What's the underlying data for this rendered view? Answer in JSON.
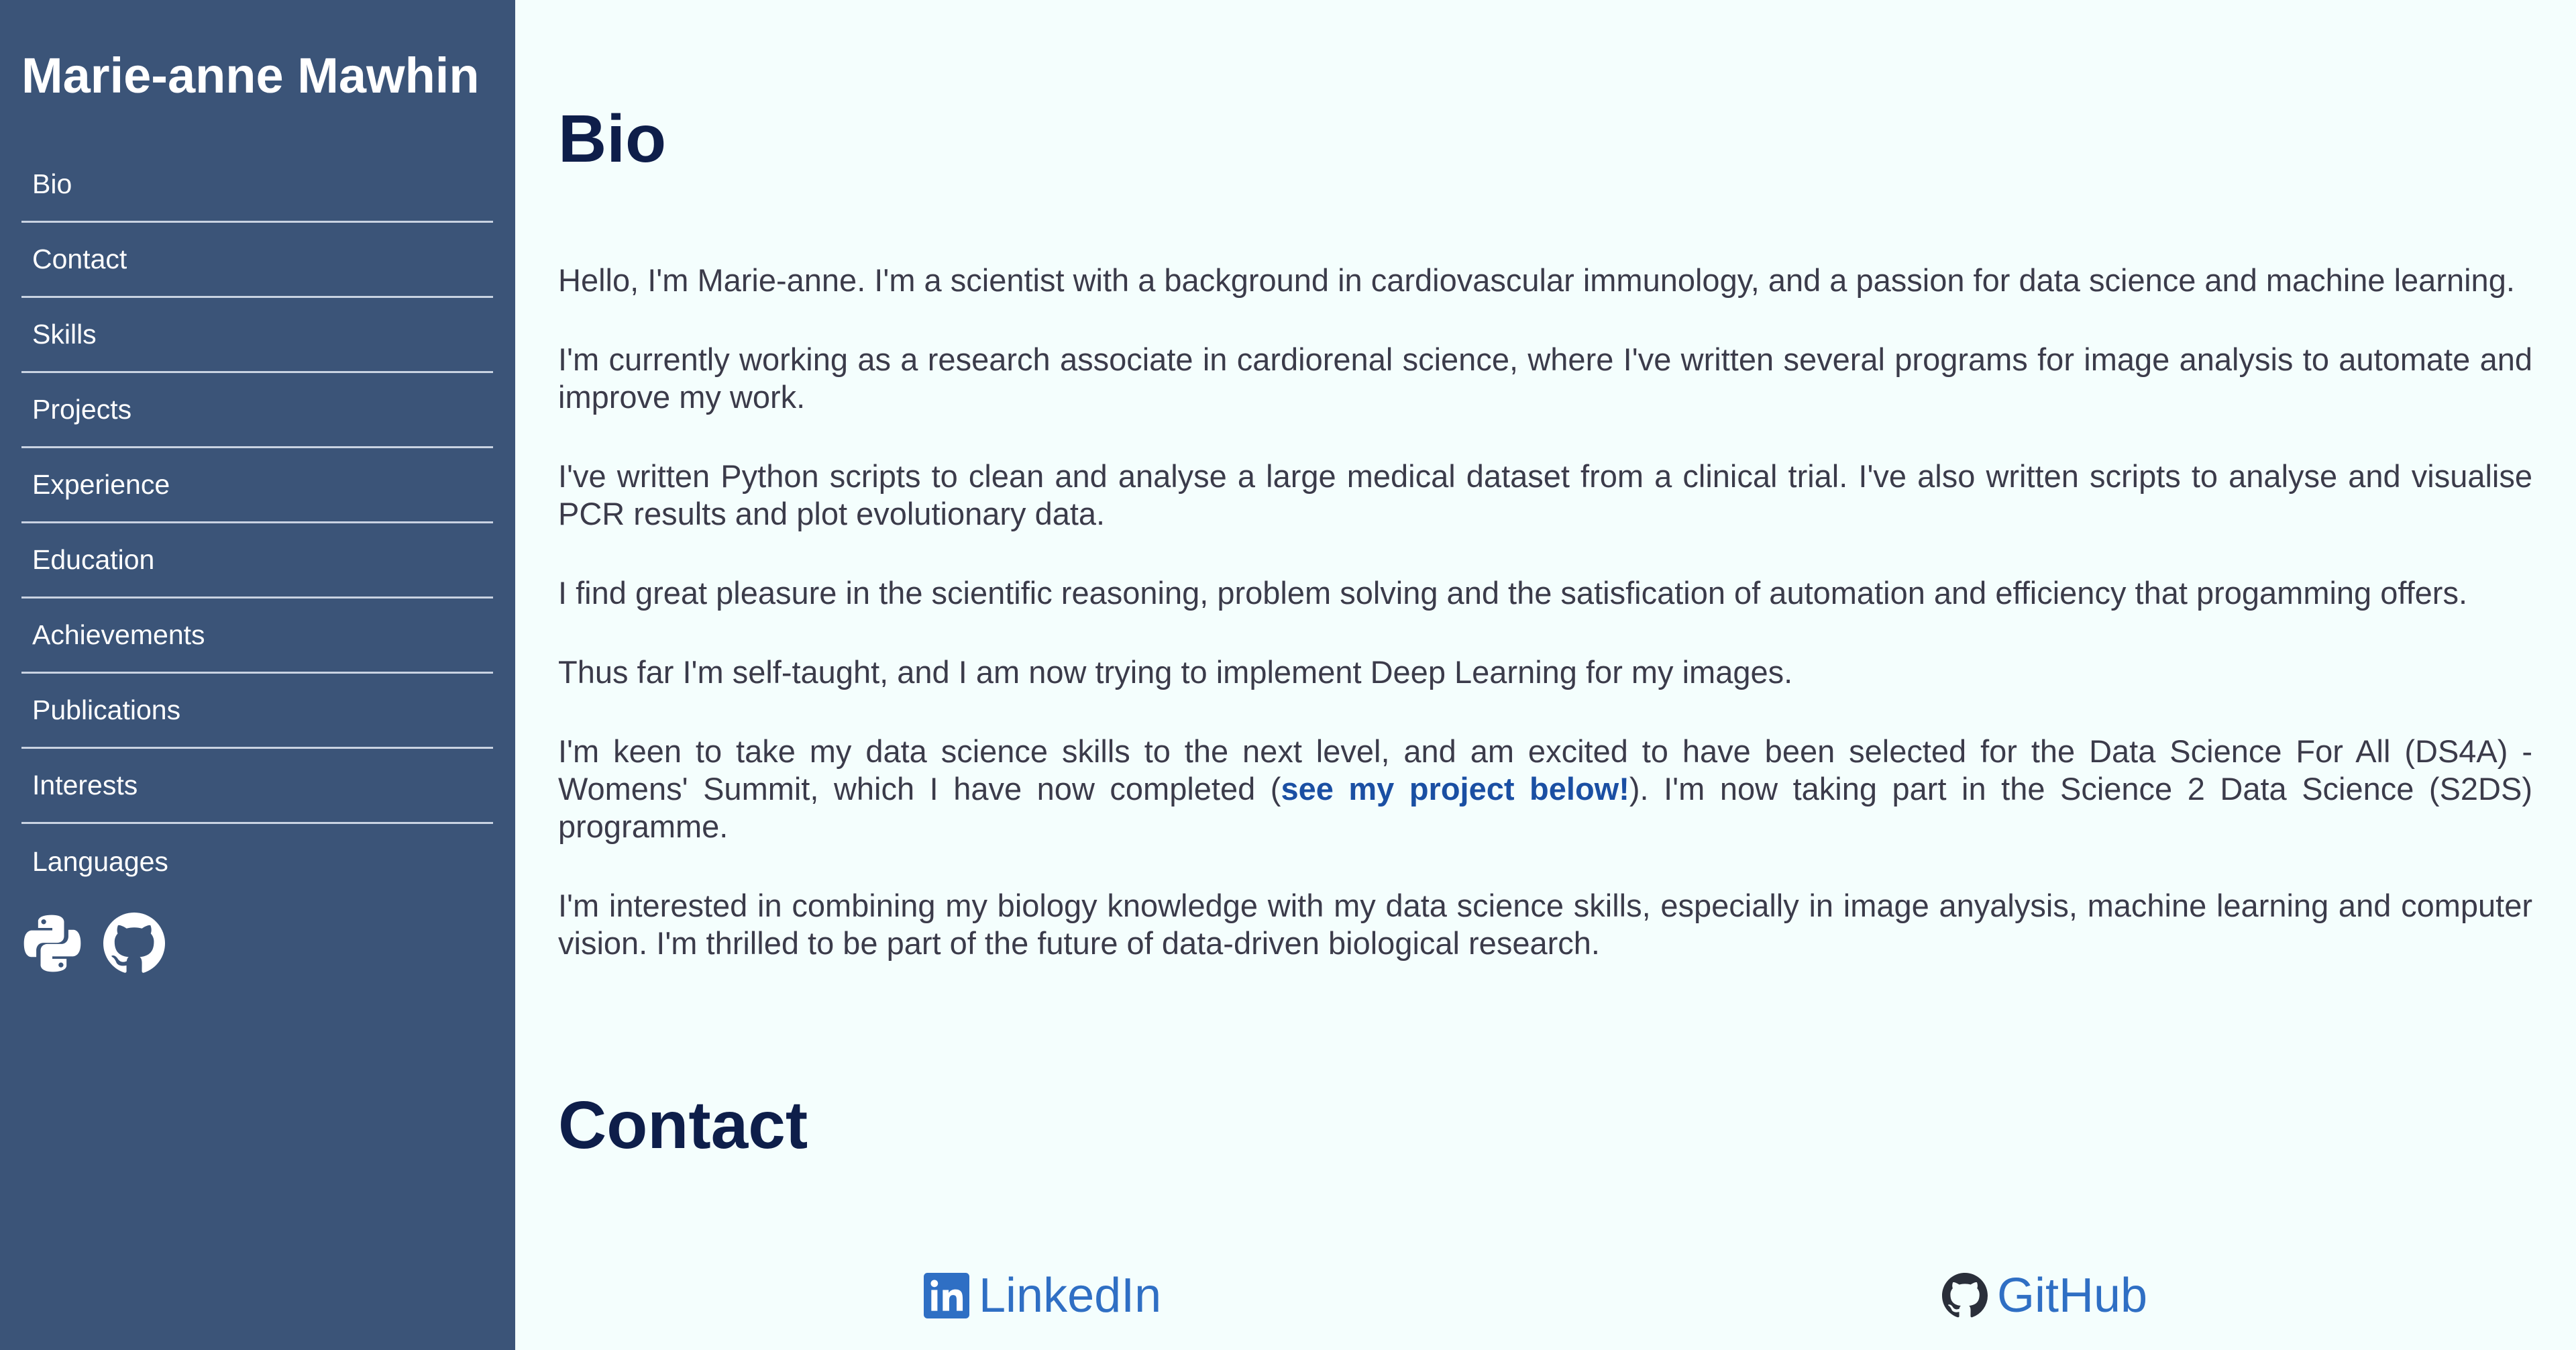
{
  "sidebar": {
    "title": "Marie-anne Mawhin",
    "items": [
      {
        "label": "Bio"
      },
      {
        "label": "Contact"
      },
      {
        "label": "Skills"
      },
      {
        "label": "Projects"
      },
      {
        "label": "Experience"
      },
      {
        "label": "Education"
      },
      {
        "label": "Achievements"
      },
      {
        "label": "Publications"
      },
      {
        "label": "Interests"
      },
      {
        "label": "Languages"
      }
    ],
    "icons": [
      "python-icon",
      "github-icon"
    ]
  },
  "bio": {
    "heading": "Bio",
    "paragraphs": [
      "Hello, I'm Marie-anne. I'm a scientist with a background in cardiovascular immunology, and a passion for data science and machine learning.",
      "I'm currently working as a research associate in cardiorenal science, where I've written several programs for image analysis to automate and improve my work.",
      "I've written Python scripts to clean and analyse a large medical dataset from a clinical trial. I've also written scripts to analyse and visualise PCR results and plot evolutionary data.",
      "I find great pleasure in the scientific reasoning, problem solving and the satisfication of automation and efficiency that progamming offers.",
      "Thus far I'm self-taught, and I am now trying to implement Deep Learning for my images."
    ],
    "p6_before": "I'm keen to take my data science skills to the next level, and am excited to have been selected for the Data Science For All (DS4A) - Womens' Summit, which I have now completed (",
    "p6_link": "see my project below!",
    "p6_after": "). I'm now taking part in the Science 2 Data Science (S2DS) programme.",
    "p7": "I'm interested in combining my biology knowledge with my data science skills, especially in image anyalysis, machine learning and computer vision. I'm thrilled to be part of the future of data-driven biological research."
  },
  "contact": {
    "heading": "Contact",
    "linkedin_label": "LinkedIn",
    "github_label": "GitHub"
  },
  "colors": {
    "sidebar_bg": "#3b5478",
    "page_bg": "#f4fefd",
    "heading": "#0e1e4a",
    "link": "#1a4fa3",
    "contact_link": "#2f6fc4"
  }
}
